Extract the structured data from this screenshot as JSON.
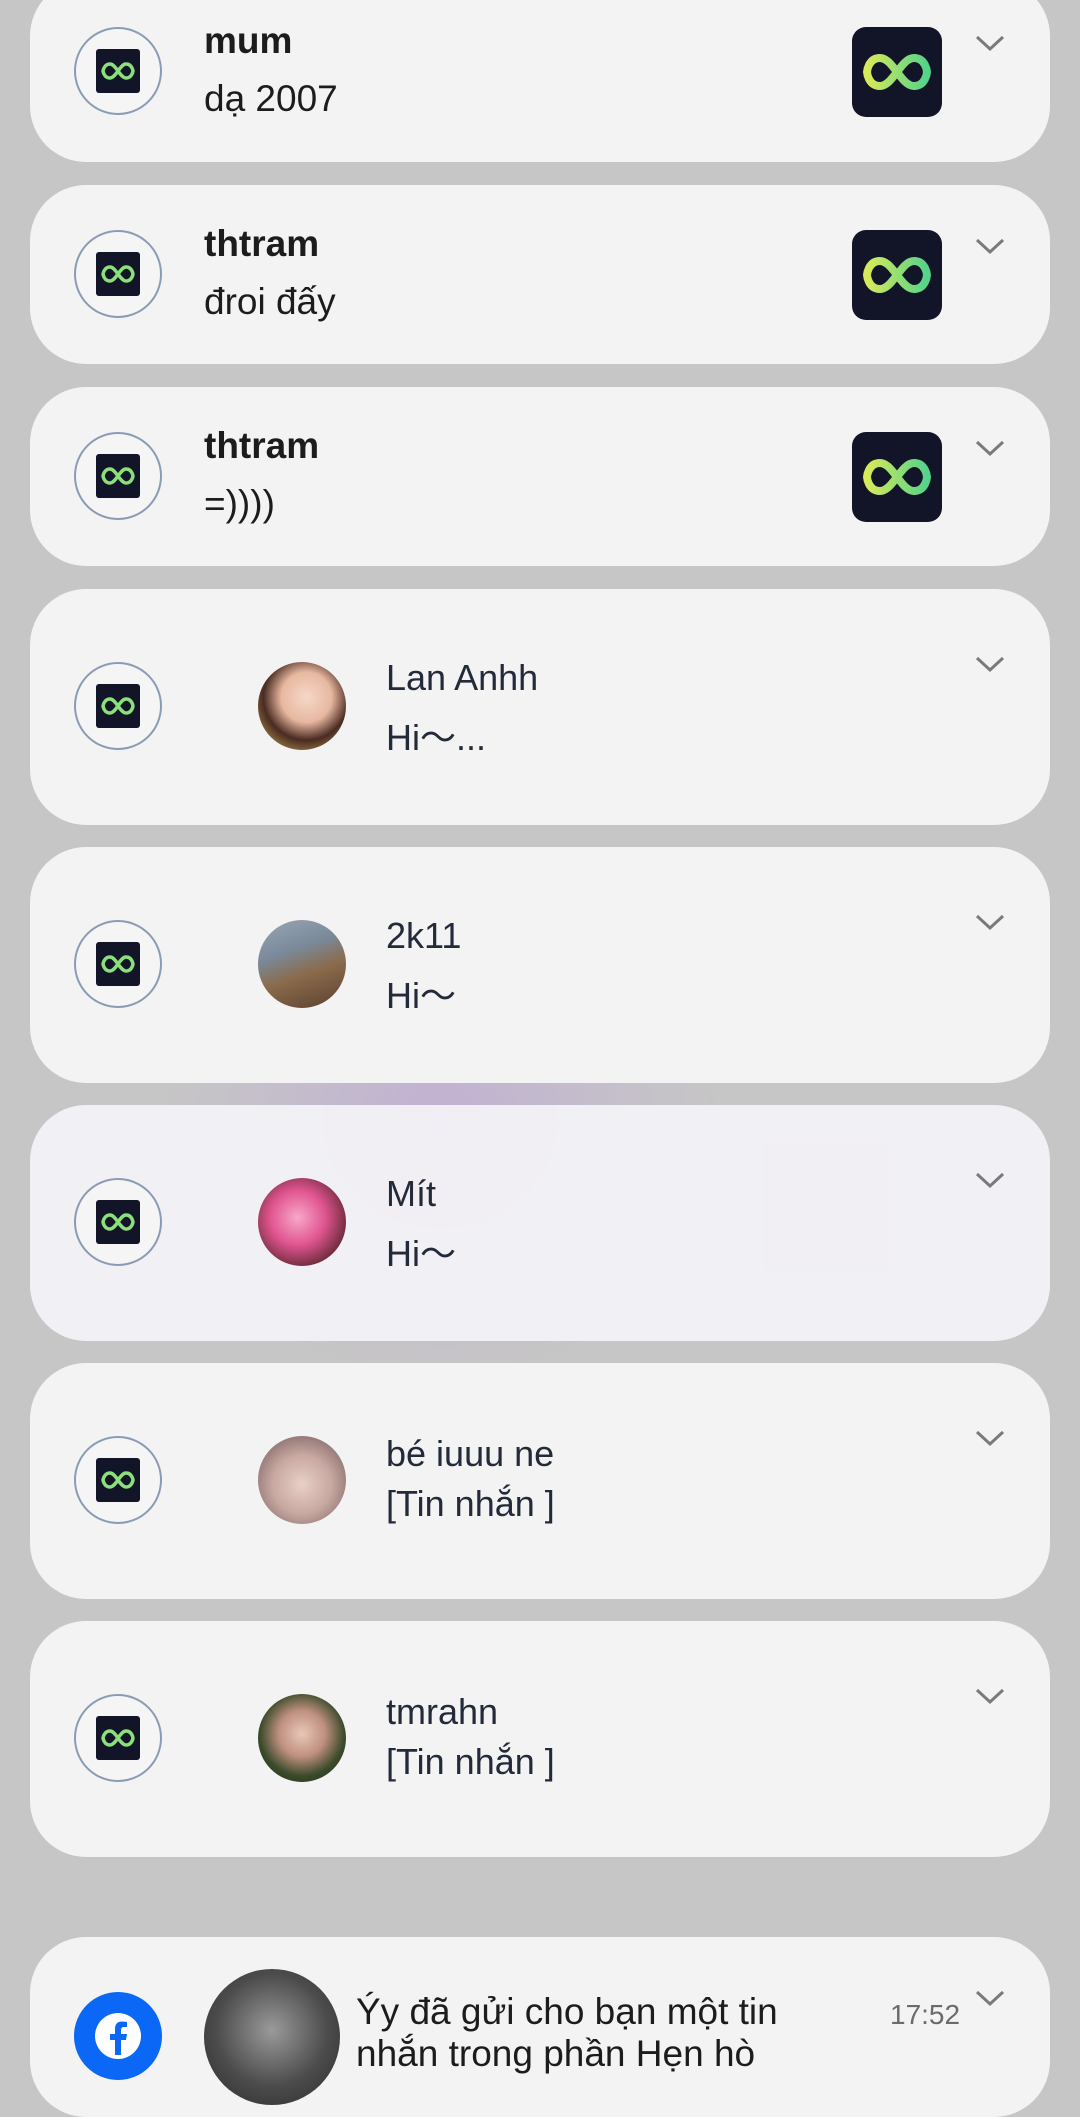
{
  "colors": {
    "background": "#c6c6c6",
    "card": "#f3f3f4",
    "app_icon_bg": "#121528",
    "facebook_blue": "#0b67f5"
  },
  "notifications": [
    {
      "title": "mum",
      "text": "dạ 2007",
      "icon": "infinity-icon"
    },
    {
      "title": "thtram",
      "text": "đroi đấy",
      "icon": "infinity-icon"
    },
    {
      "title": "thtram",
      "text": "=))))",
      "icon": "infinity-icon"
    }
  ],
  "chats": [
    {
      "name": "Lan Anhh",
      "message": "Hi～..."
    },
    {
      "name": "2k11",
      "message": "Hi～"
    },
    {
      "name": "Mít",
      "message": "Hi～"
    },
    {
      "name": "bé iuuu ne",
      "message": "[Tin nhắn ]"
    },
    {
      "name": "tmrahn",
      "message": "[Tin nhắn ]"
    }
  ],
  "facebook": {
    "text": "Ýy đã gửi cho bạn một tin nhắn trong phần Hẹn hò",
    "time": "17:52",
    "icon": "facebook-icon"
  }
}
